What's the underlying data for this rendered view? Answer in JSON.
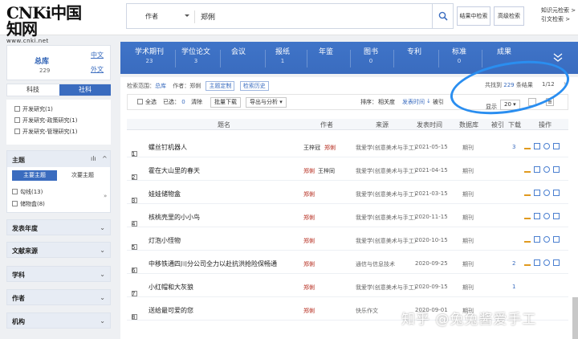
{
  "header": {
    "logo_text": "CNKi中国知网",
    "logo_url": "www.cnki.net",
    "search_field": "作者",
    "search_value": "郑俐",
    "btn_in_results": "结果中检索",
    "btn_advanced": "高级检索",
    "link_knowledge": "知识元检索 >",
    "link_citation": "引文检索 >"
  },
  "nav": [
    {
      "label": "学术期刊",
      "count": "23"
    },
    {
      "label": "学位论文",
      "count": "3"
    },
    {
      "label": "会议",
      "count": ""
    },
    {
      "label": "报纸",
      "count": "1"
    },
    {
      "label": "年鉴",
      "count": ""
    },
    {
      "label": "图书",
      "count": "0"
    },
    {
      "label": "专利",
      "count": ""
    },
    {
      "label": "标准",
      "count": "0"
    },
    {
      "label": "成果",
      "count": ""
    }
  ],
  "library": {
    "title": "总库",
    "count": "229",
    "zh": "中文",
    "wai": "外文"
  },
  "tabs": {
    "kj": "科技",
    "sk": "社科"
  },
  "categories": [
    "开发研究(1)",
    "开发研究-政策研究(1)",
    "开发研究-管理研究(1)"
  ],
  "topic": {
    "title": "主题",
    "main": "主要主题",
    "sub": "次要主题",
    "items": [
      "勾线(13)",
      "储物盒(8)"
    ]
  },
  "facets": [
    "发表年度",
    "文献来源",
    "学科",
    "作者",
    "机构"
  ],
  "crumb": {
    "label": "检索范围：",
    "scope": "总库",
    "author_label": "作者：",
    "author": "郑俐",
    "p1": "主题定制",
    "p2": "检索历史"
  },
  "found": {
    "prefix": "共找到",
    "count": "229",
    "suffix": "条结果",
    "pager": "1/12"
  },
  "toolbar": {
    "select_all": "全选",
    "selected": "已选：",
    "sel_count": "0",
    "clear": "清除",
    "batch": "批量下载",
    "export": "导出与分析 ▾",
    "sort_label": "排序：",
    "relevance": "相关度",
    "pubtime": "发表时间",
    "cited": "被引",
    "show": "显示",
    "page_size": "20"
  },
  "columns": [
    "题名",
    "作者",
    "来源",
    "发表时间",
    "数据库",
    "被引",
    "下载",
    "操作"
  ],
  "rows": [
    {
      "n": "1",
      "title": "螺丝钉机器人",
      "author1": "王梓冠",
      "author2": "郑俐",
      "source": "我爱学(创意美术与手工)",
      "date": "2021-05-15",
      "db": "期刊",
      "cited": "",
      "dl": "3"
    },
    {
      "n": "2",
      "title": "霍在大山里的春天",
      "author1": "郑俐",
      "author2": "王梓同",
      "source": "我爱学(创意美术与手工)",
      "date": "2021-04-15",
      "db": "期刊",
      "cited": "",
      "dl": ""
    },
    {
      "n": "3",
      "title": "娃娃储物盒",
      "author1": "郑俐",
      "author2": "",
      "source": "我爱学(创意美术与手工)",
      "date": "2021-03-15",
      "db": "期刊",
      "cited": "",
      "dl": ""
    },
    {
      "n": "4",
      "title": "核桃壳里的小小鸟",
      "author1": "郑俐",
      "author2": "",
      "source": "我爱学(创意美术与手工)",
      "date": "2020-11-15",
      "db": "期刊",
      "cited": "",
      "dl": ""
    },
    {
      "n": "5",
      "title": "灯泡小怪物",
      "author1": "郑俐",
      "author2": "",
      "source": "我爱学(创意美术与手工)",
      "date": "2020-10-15",
      "db": "期刊",
      "cited": "",
      "dl": ""
    },
    {
      "n": "6",
      "title": "中移铁通四川分公司全力以赴抗洪抢险保畅通",
      "author1": "郑俐",
      "author2": "",
      "source": "通信与信息技术",
      "date": "2020-09-25",
      "db": "期刊",
      "cited": "",
      "dl": "2"
    },
    {
      "n": "7",
      "title": "小红帽和大灰狼",
      "author1": "郑俐",
      "author2": "",
      "source": "我爱学(创意美术与手工)",
      "date": "2020-09-15",
      "db": "期刊",
      "cited": "",
      "dl": "1"
    },
    {
      "n": "8",
      "title": "送给最可爱的您",
      "author1": "郑俐",
      "author2": "",
      "source": "快乐作文",
      "date": "2020-09-01",
      "db": "期刊",
      "cited": "",
      "dl": ""
    }
  ],
  "watermark": "知乎 @兔兔酱爱手工",
  "colors": {
    "brand": "#3a6cbf",
    "author_red": "#b52a1c",
    "highlight": "#2a8ef0"
  }
}
